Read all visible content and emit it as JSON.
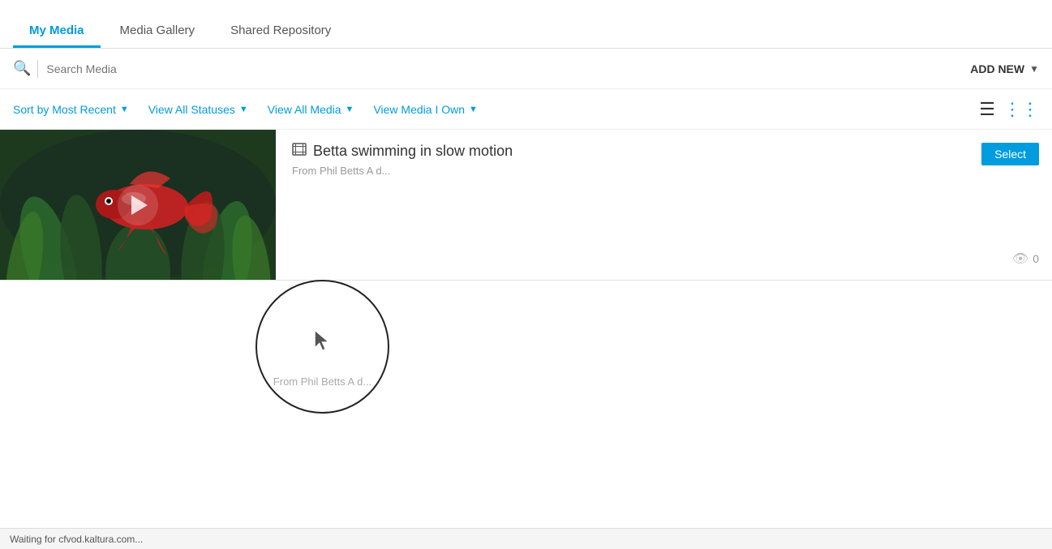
{
  "tabs": [
    {
      "id": "my-media",
      "label": "My Media",
      "active": true
    },
    {
      "id": "media-gallery",
      "label": "Media Gallery",
      "active": false
    },
    {
      "id": "shared-repository",
      "label": "Shared Repository",
      "active": false
    }
  ],
  "search": {
    "placeholder": "Search Media",
    "value": ""
  },
  "add_new": {
    "label": "ADD NEW"
  },
  "filters": [
    {
      "id": "sort",
      "label": "Sort by Most Recent"
    },
    {
      "id": "status",
      "label": "View All Statuses"
    },
    {
      "id": "media",
      "label": "View All Media"
    },
    {
      "id": "ownership",
      "label": "View Media I Own"
    }
  ],
  "view_modes": {
    "list": "☰",
    "grid": "⊞"
  },
  "media_item": {
    "title": "Betta swimming in slow motion",
    "meta": "From Phil Betts A d...",
    "views": "0",
    "select_label": "Select"
  },
  "status_bar": {
    "text": "Waiting for cfvod.kaltura.com..."
  },
  "cursor_text": "From Phil Betts A d..."
}
